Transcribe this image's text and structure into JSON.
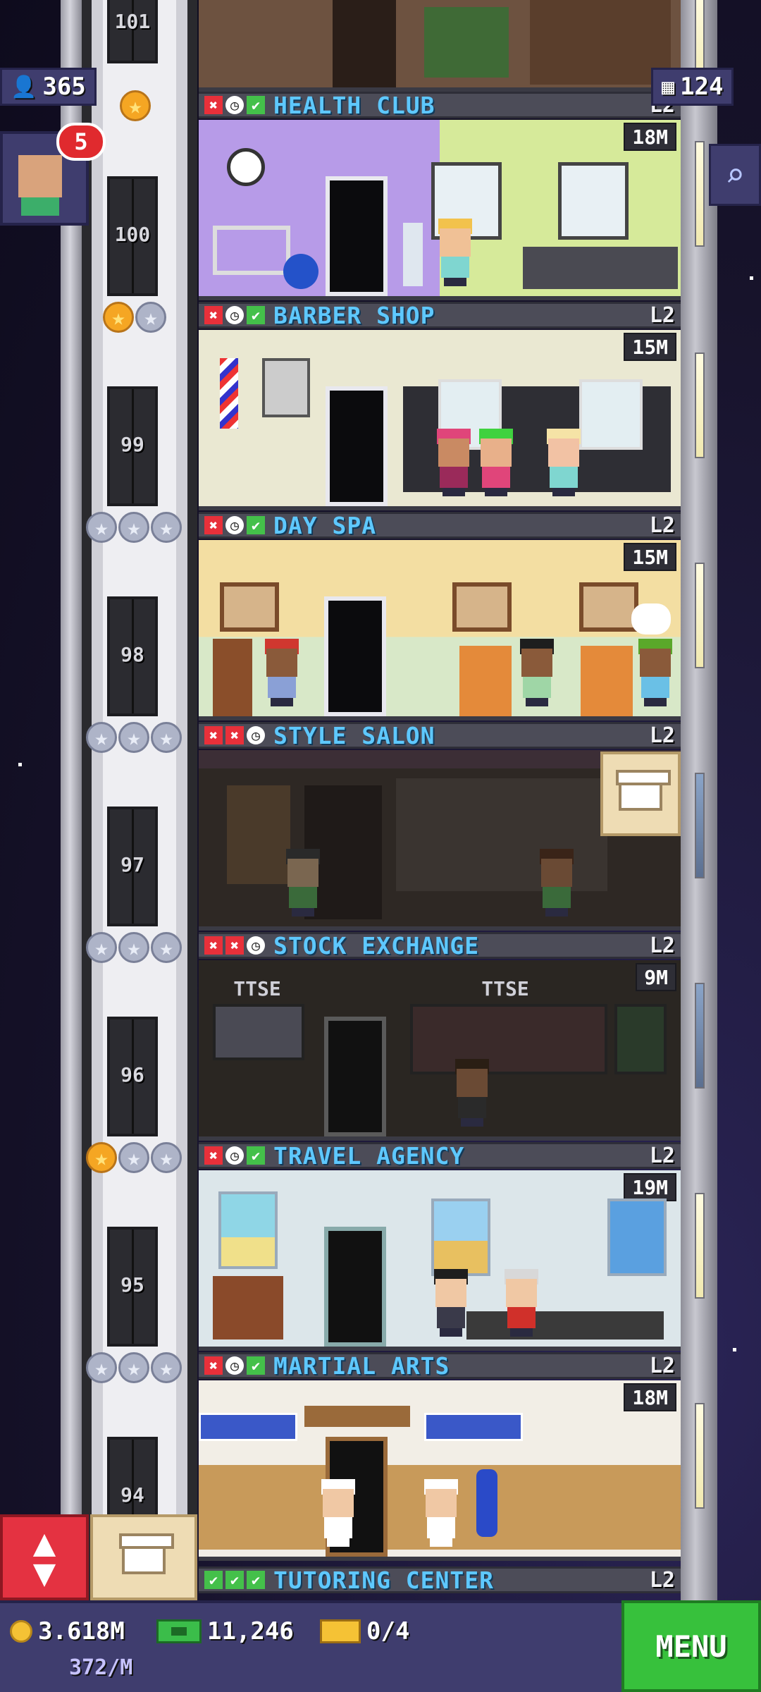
{
  "hud": {
    "population": "365",
    "population_icon": "person-icon",
    "floors": "124",
    "floors_icon": "building-grid-icon",
    "notification_count": "5",
    "search_icon": "magnifier-icon"
  },
  "floors": [
    {
      "number": "101"
    },
    {
      "number": "100",
      "name": "HEALTH CLUB",
      "level": "L2",
      "cost": "18M",
      "status": [
        "x",
        "clock",
        "check"
      ]
    },
    {
      "number": "99",
      "name": "BARBER SHOP",
      "level": "L2",
      "cost": "15M",
      "status": [
        "x",
        "clock",
        "check"
      ]
    },
    {
      "number": "98",
      "name": "DAY SPA",
      "level": "L2",
      "cost": "15M",
      "status": [
        "x",
        "clock",
        "check"
      ]
    },
    {
      "number": "97",
      "name": "STYLE SALON",
      "level": "L2",
      "cost": "",
      "status": [
        "x",
        "x",
        "clock"
      ]
    },
    {
      "number": "96",
      "name": "STOCK EXCHANGE",
      "level": "L2",
      "cost": "9M",
      "status": [
        "x",
        "x",
        "clock"
      ],
      "signs": [
        "TTSE",
        "TTSE"
      ]
    },
    {
      "number": "95",
      "name": "TRAVEL AGENCY",
      "level": "L2",
      "cost": "19M",
      "status": [
        "x",
        "clock",
        "check"
      ]
    },
    {
      "number": "94",
      "name": "MARTIAL ARTS",
      "level": "L2",
      "cost": "18M",
      "status": [
        "x",
        "clock",
        "check"
      ]
    },
    {
      "number": "",
      "name": "TUTORING CENTER",
      "level": "L2",
      "cost": "",
      "status": [
        "check",
        "check",
        "check"
      ]
    }
  ],
  "floor_stars": [
    [
      "gold"
    ],
    [
      "gold",
      "silver"
    ],
    [
      "silver",
      "silver",
      "silver"
    ],
    [
      "silver",
      "silver",
      "silver"
    ],
    [
      "silver",
      "silver",
      "silver"
    ],
    [
      "gold",
      "silver",
      "silver"
    ],
    [
      "silver",
      "silver",
      "silver"
    ]
  ],
  "status_glyphs": {
    "x": "✖",
    "clock": "◷",
    "check": "✔"
  },
  "bottom": {
    "coins": "3.618M",
    "coins_rate": "372/M",
    "bux": "11,246",
    "tickets": "0/4",
    "menu_label": "MENU"
  },
  "colors": {
    "floor_name": "#5ec8ff",
    "menu_green": "#37c13c",
    "elevator_red": "#e43241",
    "hud_panel": "#3f3d6e"
  }
}
